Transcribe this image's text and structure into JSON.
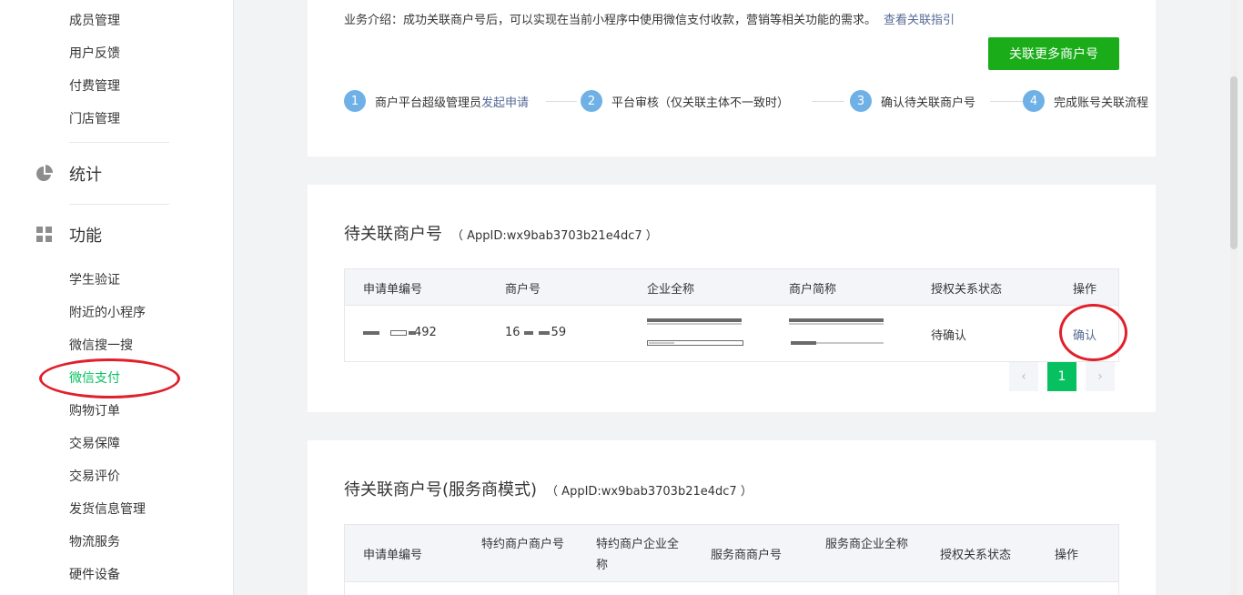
{
  "sidebar": {
    "top_items": [
      {
        "label": "成员管理"
      },
      {
        "label": "用户反馈"
      },
      {
        "label": "付费管理"
      },
      {
        "label": "门店管理"
      }
    ],
    "stats_label": "统计",
    "features_label": "功能",
    "feature_items": [
      {
        "label": "学生验证"
      },
      {
        "label": "附近的小程序"
      },
      {
        "label": "微信搜一搜"
      },
      {
        "label": "微信支付"
      },
      {
        "label": "购物订单"
      },
      {
        "label": "交易保障"
      },
      {
        "label": "交易评价"
      },
      {
        "label": "发货信息管理"
      },
      {
        "label": "物流服务"
      },
      {
        "label": "硬件设备"
      }
    ],
    "active_item": "微信支付"
  },
  "intro": {
    "text": "业务介绍：成功关联商户号后，可以实现在当前小程序中使用微信支付收款，营销等相关功能的需求。",
    "guide_link": "查看关联指引",
    "button": "关联更多商户号"
  },
  "steps": [
    {
      "num": "1",
      "text": "商户平台超级管理员",
      "link": "发起申请"
    },
    {
      "num": "2",
      "text": "平台审核（仅关联主体不一致时）",
      "link": ""
    },
    {
      "num": "3",
      "text": "确认待关联商户号",
      "link": ""
    },
    {
      "num": "4",
      "text": "完成账号关联流程",
      "link": ""
    }
  ],
  "pending": {
    "title": "待关联商户号",
    "appid": "（ AppID:wx9bab3703b21e4dc7 ）",
    "columns": [
      "申请单编号",
      "商户号",
      "企业全称",
      "商户简称",
      "授权关系状态",
      "操作"
    ],
    "row": {
      "order_no_end": "492",
      "merchant_no_start": "16",
      "merchant_no_end": "59",
      "status": "待确认",
      "action": "确认"
    },
    "pager": {
      "prev": "‹",
      "page": "1",
      "next": "›"
    }
  },
  "service": {
    "title": "待关联商户号(服务商模式)",
    "appid": "（ AppID:wx9bab3703b21e4dc7 ）",
    "columns": [
      "申请单编号",
      "特约商户商户号",
      "特约商户企业全称",
      "服务商商户号",
      "服务商企业全称",
      "授权关系状态",
      "操作"
    ]
  },
  "colors": {
    "accent": "#07c160",
    "button": "#1aad19",
    "link": "#576b95",
    "annotation": "#e0202a"
  }
}
